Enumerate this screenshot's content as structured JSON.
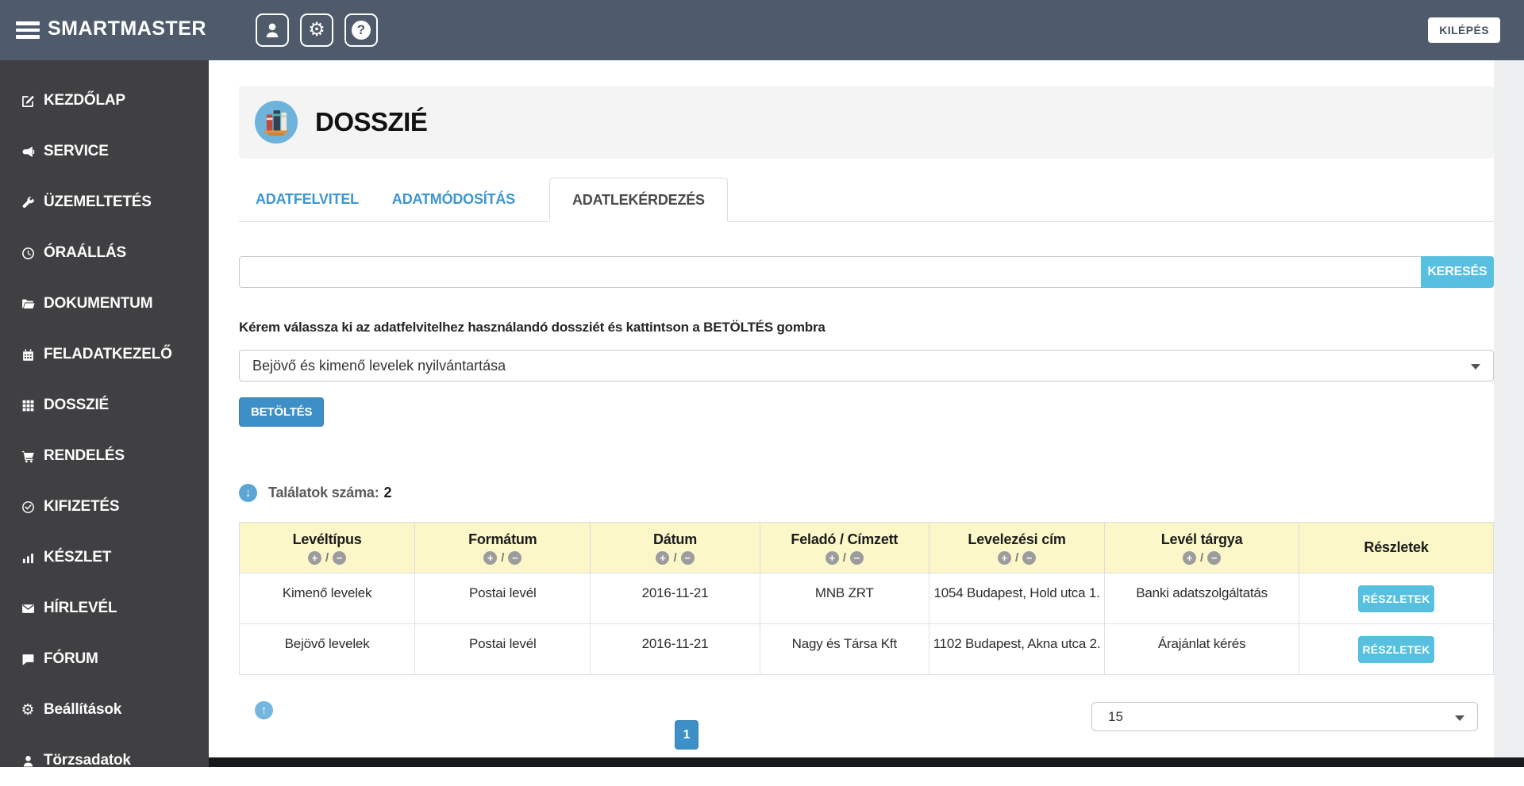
{
  "header": {
    "brand": "SMARTMASTER",
    "logout": "KILÉPÉS",
    "icons": [
      {
        "name": "user"
      },
      {
        "name": "settings",
        "glyph": "⚙"
      },
      {
        "name": "help",
        "glyph": "?"
      }
    ]
  },
  "sidebar": {
    "items": [
      {
        "label": "KEZDŐLAP",
        "icon": "pencil-square"
      },
      {
        "label": "SERVICE",
        "icon": "bullhorn"
      },
      {
        "label": "ÜZEMELTETÉS",
        "icon": "wrench"
      },
      {
        "label": "ÓRAÁLLÁS",
        "icon": "clock"
      },
      {
        "label": "DOKUMENTUM",
        "icon": "folder-open"
      },
      {
        "label": "FELADATKEZELŐ",
        "icon": "calendar"
      },
      {
        "label": "DOSSZIÉ",
        "icon": "grid"
      },
      {
        "label": "RENDELÉS",
        "icon": "shopping-cart"
      },
      {
        "label": "KIFIZETÉS",
        "icon": "check-circle"
      },
      {
        "label": "KÉSZLET",
        "icon": "bar-chart"
      },
      {
        "label": "HÍRLEVÉL",
        "icon": "envelope"
      },
      {
        "label": "FÓRUM",
        "icon": "comment"
      },
      {
        "label": "Beállítások",
        "icon": "gear"
      },
      {
        "label": "Törzsadatok",
        "icon": "user"
      }
    ]
  },
  "page": {
    "title": "DOSSZIÉ",
    "tabs": [
      {
        "label": "ADATFELVITEL",
        "active": false
      },
      {
        "label": "ADATMÓDOSÍTÁS",
        "active": false
      },
      {
        "label": "ADATLEKÉRDEZÉS",
        "active": true
      }
    ],
    "search": {
      "value": "",
      "button": "KERESÉS"
    },
    "instruction": "Kérem válassza ki az adatfelvitelhez használandó dossziét és kattintson a BETÖLTÉS gombra",
    "dossier_select": {
      "value": "Bejövő és kimenő levelek nyilvántartása"
    },
    "load_button": "BETÖLTÉS",
    "results": {
      "label": "Találatok száma:",
      "count": "2"
    },
    "table": {
      "columns": [
        "Levéltípus",
        "Formátum",
        "Dátum",
        "Feladó / Címzett",
        "Levelezési cím",
        "Levél tárgya",
        "Részletek"
      ],
      "sort_asc": "+",
      "sort_sep": "/",
      "sort_desc": "−",
      "rows": [
        {
          "cells": [
            "Kimenő levelek",
            "Postai levél",
            "2016-11-21",
            "MNB ZRT",
            "1054 Budapest, Hold utca 1.",
            "Banki adatszolgáltatás"
          ],
          "button": "RÉSZLETEK"
        },
        {
          "cells": [
            "Bejövő levelek",
            "Postai levél",
            "2016-11-21",
            "Nagy és Társa Kft",
            "1102 Budapest, Akna utca 2.",
            "Árajánlat kérés"
          ],
          "button": "RÉSZLETEK"
        }
      ]
    },
    "pagination": {
      "current": "1",
      "page_size": "15"
    }
  },
  "colors": {
    "topbar": "#4f5b6b",
    "sidebar": "#403f41",
    "accent_blue": "#3d8fc7",
    "light_blue": "#57bfe0",
    "tab_link": "#3b97d3",
    "table_header_bg": "#fbf7c8"
  }
}
